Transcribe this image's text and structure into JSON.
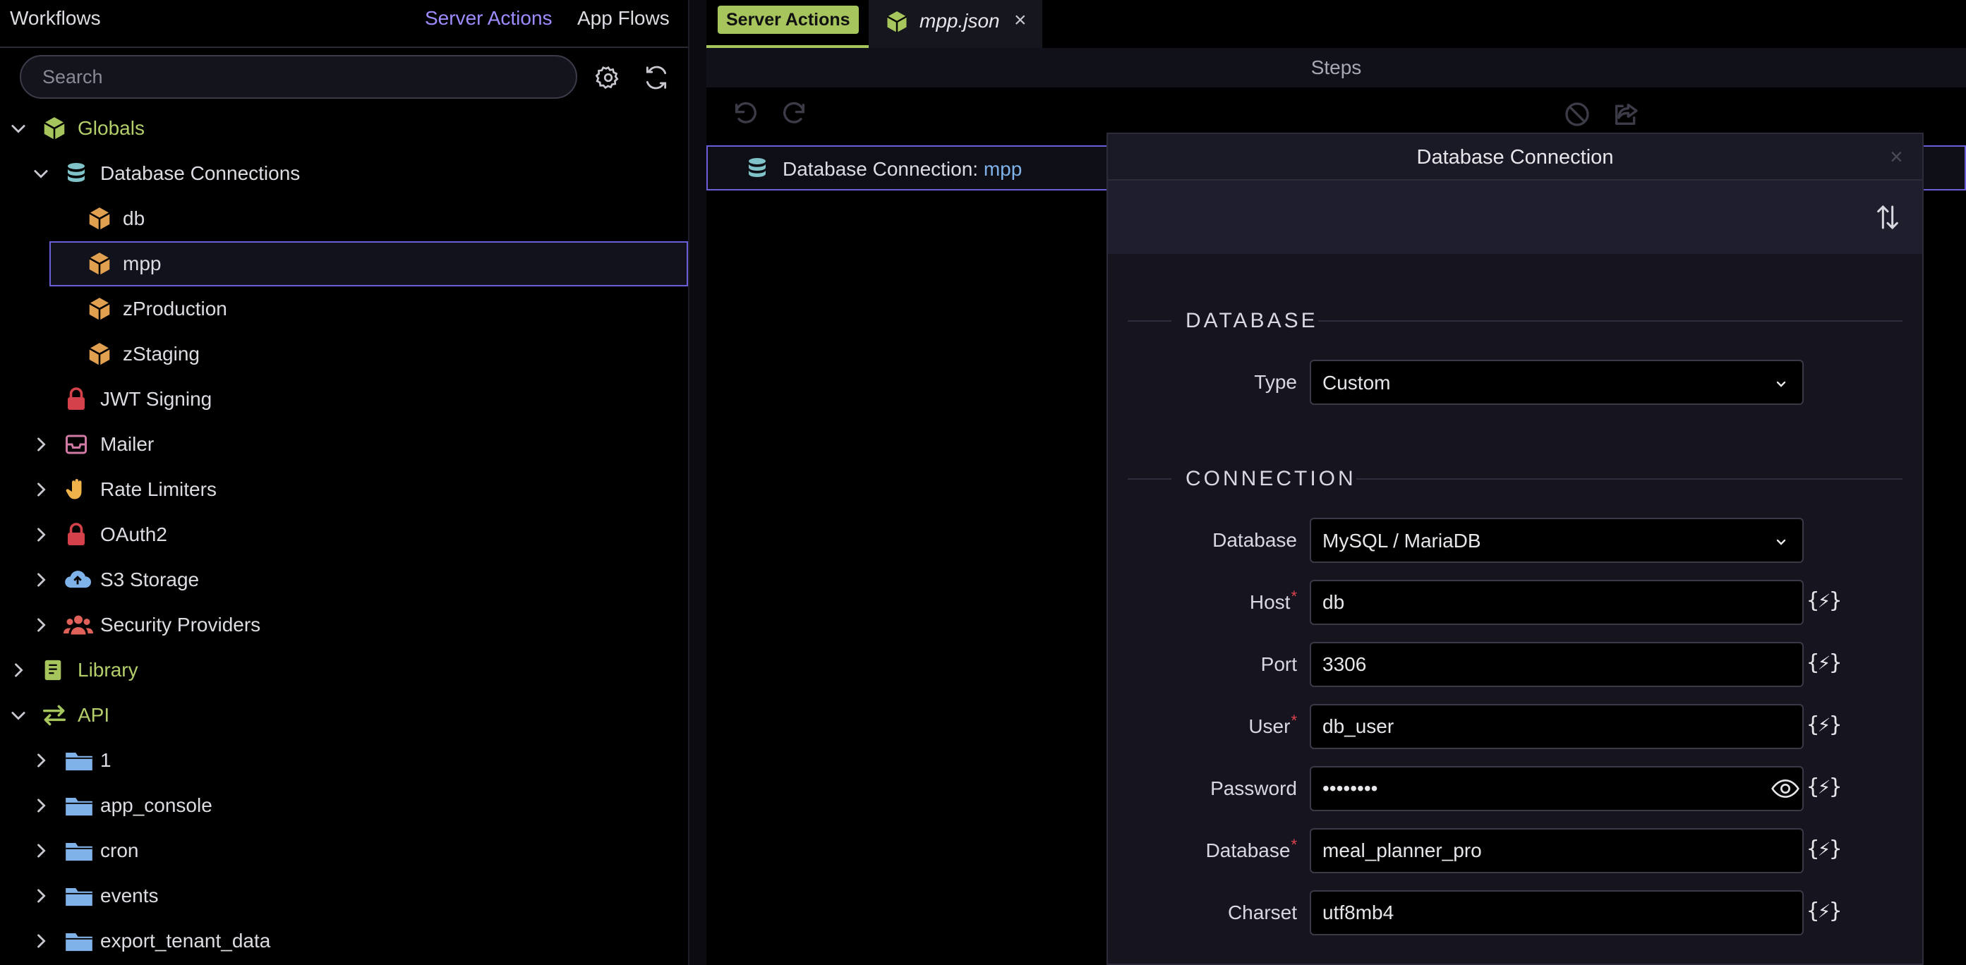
{
  "left_panel": {
    "title": "Workflows",
    "tabs": [
      {
        "label": "Server Actions",
        "active": true
      },
      {
        "label": "App Flows",
        "active": false
      }
    ],
    "search_placeholder": "Search",
    "tree": [
      {
        "label": "Globals",
        "icon": "globals-box-icon",
        "level": 0,
        "expanded": true,
        "highlight": true
      },
      {
        "label": "Database Connections",
        "icon": "database-icon",
        "level": 1,
        "expanded": true
      },
      {
        "label": "db",
        "icon": "box-icon",
        "level": 2
      },
      {
        "label": "mpp",
        "icon": "box-icon",
        "level": 2,
        "selected": true
      },
      {
        "label": "zProduction",
        "icon": "box-icon",
        "level": 2
      },
      {
        "label": "zStaging",
        "icon": "box-icon",
        "level": 2
      },
      {
        "label": "JWT Signing",
        "icon": "lock-icon",
        "level": 1
      },
      {
        "label": "Mailer",
        "icon": "mail-icon",
        "level": 1,
        "expanded": false
      },
      {
        "label": "Rate Limiters",
        "icon": "hand-icon",
        "level": 1,
        "expanded": false
      },
      {
        "label": "OAuth2",
        "icon": "lock-icon",
        "level": 1,
        "expanded": false
      },
      {
        "label": "S3 Storage",
        "icon": "cloud-upload-icon",
        "level": 1,
        "expanded": false
      },
      {
        "label": "Security Providers",
        "icon": "users-icon",
        "level": 1,
        "expanded": false
      },
      {
        "label": "Library",
        "icon": "book-icon",
        "level": 0,
        "expanded": false,
        "highlight": true
      },
      {
        "label": "API",
        "icon": "swap-arrows-icon",
        "level": 0,
        "expanded": true,
        "highlight": true
      },
      {
        "label": "1",
        "icon": "folder-icon",
        "level": 1,
        "expanded": false
      },
      {
        "label": "app_console",
        "icon": "folder-icon",
        "level": 1,
        "expanded": false
      },
      {
        "label": "cron",
        "icon": "folder-icon",
        "level": 1,
        "expanded": false
      },
      {
        "label": "events",
        "icon": "folder-icon",
        "level": 1,
        "expanded": false
      },
      {
        "label": "export_tenant_data",
        "icon": "folder-icon",
        "level": 1,
        "expanded": false
      }
    ]
  },
  "editor_tabs": {
    "server_actions_label": "Server Actions",
    "file_tab_label": "mpp.json",
    "file_tab_close": "×"
  },
  "steps": {
    "title": "Steps",
    "row_label": "Database Connection: ",
    "row_value": "mpp"
  },
  "modal": {
    "title": "Database Connection",
    "close": "×",
    "sections": {
      "database": "DATABASE",
      "connection": "CONNECTION"
    },
    "fields": {
      "type": {
        "label": "Type",
        "value": "Custom"
      },
      "database_engine": {
        "label": "Database",
        "value": "MySQL / MariaDB"
      },
      "host": {
        "label": "Host",
        "value": "db",
        "required": true
      },
      "port": {
        "label": "Port",
        "value": "3306"
      },
      "user": {
        "label": "User",
        "value": "db_user",
        "required": true
      },
      "password": {
        "label": "Password",
        "value": "••••••••"
      },
      "database_name": {
        "label": "Database",
        "value": "meal_planner_pro",
        "required": true
      },
      "charset": {
        "label": "Charset",
        "value": "utf8mb4"
      }
    },
    "dynamic_symbol": "{⚡}",
    "required_mark": "*"
  },
  "colors": {
    "accent_purple": "#9b8cff",
    "accent_green": "#a6c55c",
    "box_orange": "#e0a050",
    "db_teal": "#7fc3c9",
    "lock_red": "#d4414a",
    "folder_blue": "#7fb2e8",
    "required_red": "#e0444e"
  }
}
